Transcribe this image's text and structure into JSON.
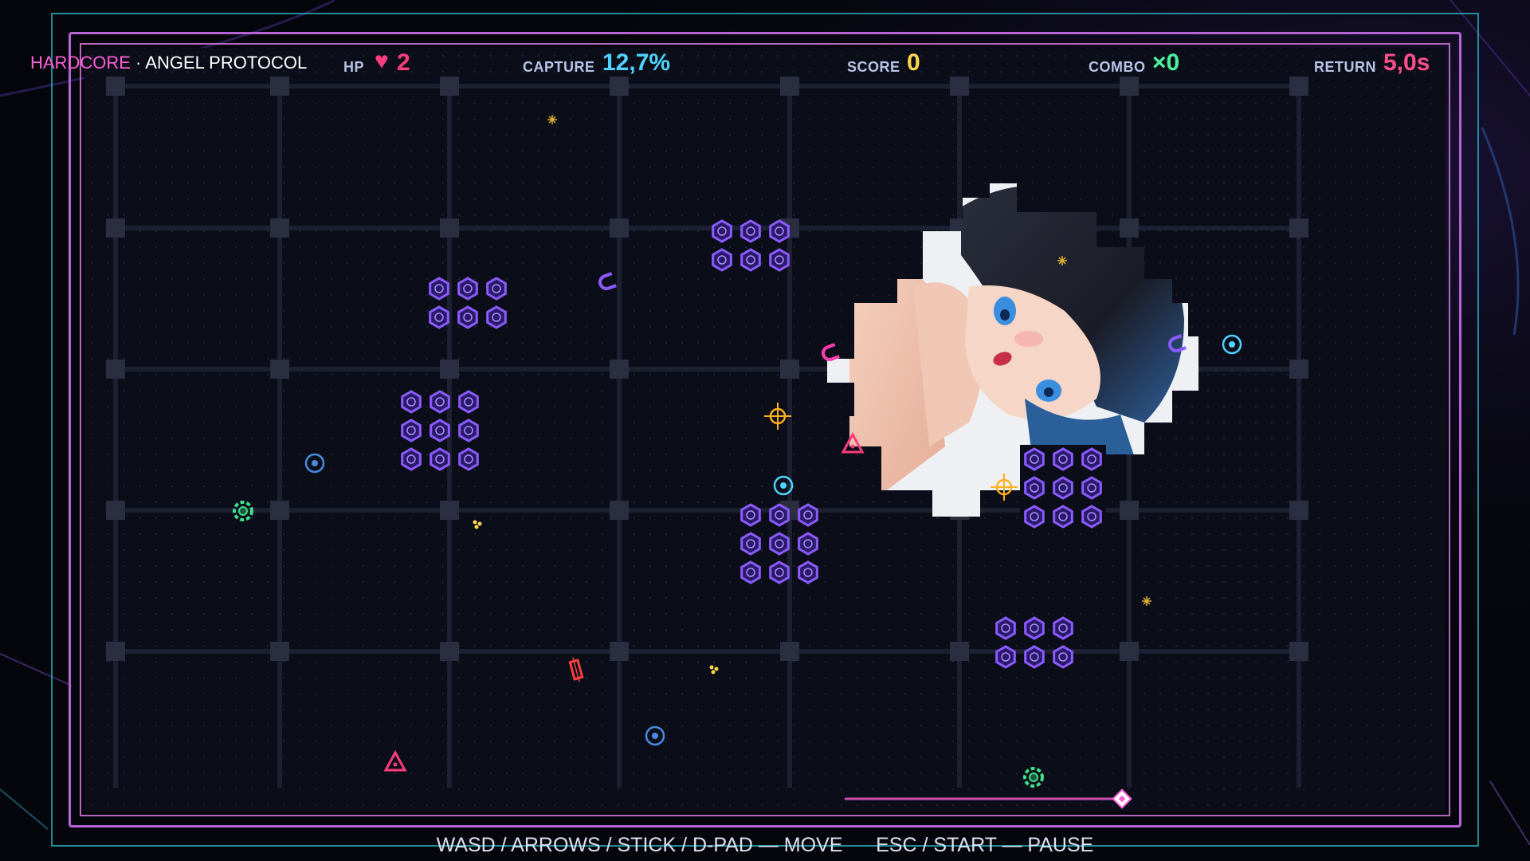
{
  "hud": {
    "mode_label": "HARDCORE",
    "mode_separator": "·",
    "mode_name": "ANGEL PROTOCOL",
    "hp_label": "HP",
    "hp_value": "2",
    "capture_label": "CAPTURE",
    "capture_value": "12,7%",
    "score_label": "SCORE",
    "score_value": "0",
    "combo_label": "COMBO",
    "combo_value": "×0",
    "return_label": "RETURN",
    "return_value": "5,0s"
  },
  "controls_text": "WASD / ARROWS / STICK / D-PAD — MOVE      ESC / START — PAUSE",
  "colors": {
    "accent_pink": "#ff5ed8",
    "accent_cyan": "#2fb7c4",
    "hp": "#ff3d7e",
    "capture": "#4fd4ff",
    "score": "#ffd84a",
    "combo": "#4df0a0",
    "return": "#ff4f8a",
    "enemy_cluster": "#7a4dff"
  },
  "icons": {
    "heart": "heart-icon",
    "enemy_block": "hexagon-enemy-icon",
    "player": "diamond-player-icon",
    "magnet": "magnet-icon",
    "crosshair": "crosshair-icon",
    "triangle": "triangle-enemy-icon",
    "ring": "ring-enemy-icon",
    "gear": "gear-enemy-icon",
    "spark": "spark-icon"
  },
  "capture_progress": 0.127,
  "revealed_image": "anime girl with black bob hair and blue eyes"
}
